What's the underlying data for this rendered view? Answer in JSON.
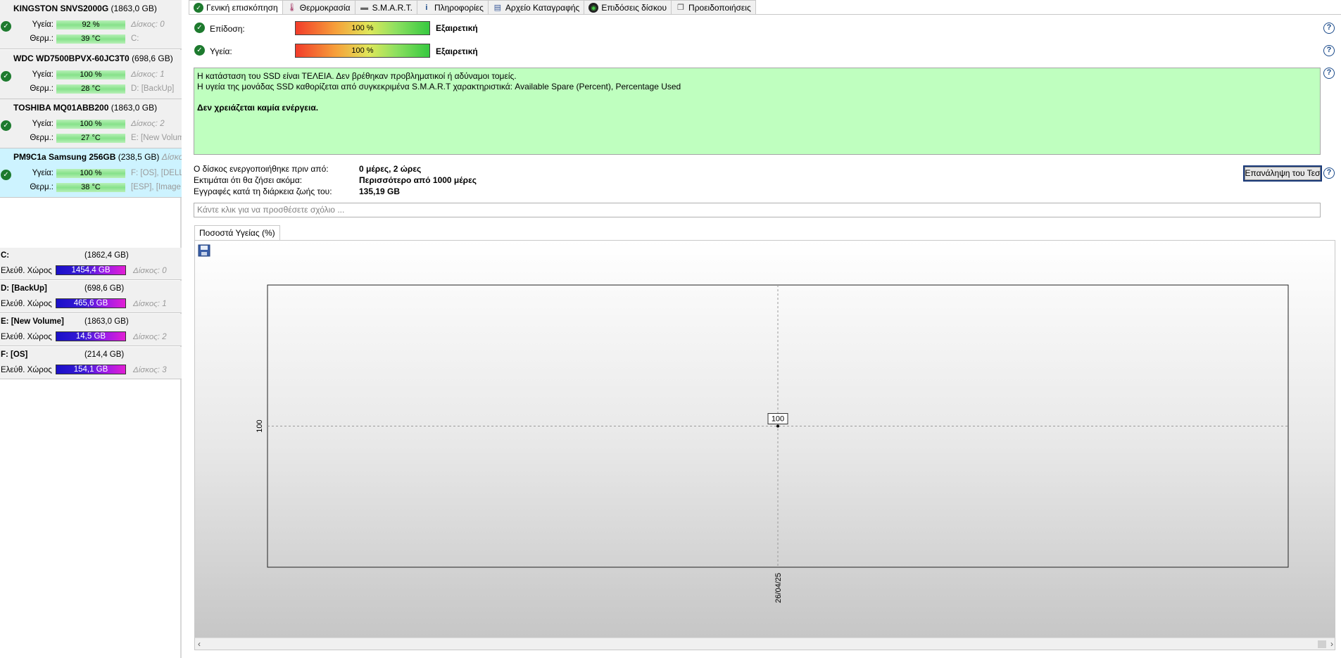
{
  "drives": [
    {
      "model": "KINGSTON SNVS2000G",
      "capacity": "(1863,0 GB)",
      "health_label": "Υγεία:",
      "health": "92 %",
      "temp_label": "Θερμ.:",
      "temp": "39 °C",
      "disk": "Δίσκος: 0",
      "volumes": "C:",
      "volumes2": ""
    },
    {
      "model": "WDC WD7500BPVX-60JC3T0",
      "capacity": "(698,6 GB)",
      "health_label": "Υγεία:",
      "health": "100 %",
      "temp_label": "Θερμ.:",
      "temp": "28 °C",
      "disk": "Δίσκος: 1",
      "volumes": "D: [BackUp]",
      "volumes2": ""
    },
    {
      "model": "TOSHIBA MQ01ABB200",
      "capacity": "(1863,0 GB)",
      "health_label": "Υγεία:",
      "health": "100 %",
      "temp_label": "Θερμ.:",
      "temp": "27 °C",
      "disk": "Δίσκος: 2",
      "volumes": "E: [New Volum",
      "volumes2": ""
    },
    {
      "model": "PM9C1a Samsung 256GB",
      "capacity": "(238,5 GB)",
      "health_label": "Υγεία:",
      "health": "100 %",
      "temp_label": "Θερμ.:",
      "temp": "38 °C",
      "disk": "Δίσκος",
      "volumes": "F: [OS],  [DELL",
      "volumes2": "[ESP],  [Image"
    }
  ],
  "volumes": [
    {
      "name": "C:",
      "size": "(1862,4 GB)",
      "free_label": "Ελεύθ. Χώρος",
      "free": "1454,4 GB",
      "disk": "Δίσκος: 0"
    },
    {
      "name": "D: [BackUp]",
      "size": "(698,6 GB)",
      "free_label": "Ελεύθ. Χώρος",
      "free": "465,6 GB",
      "disk": "Δίσκος: 1"
    },
    {
      "name": "E: [New Volume]",
      "size": "(1863,0 GB)",
      "free_label": "Ελεύθ. Χώρος",
      "free": "14,5 GB",
      "disk": "Δίσκος: 2"
    },
    {
      "name": "F: [OS]",
      "size": "(214,4 GB)",
      "free_label": "Ελεύθ. Χώρος",
      "free": "154,1 GB",
      "disk": "Δίσκος: 3"
    }
  ],
  "tabs": [
    {
      "label": "Γενική επισκόπηση",
      "icon": "check-icon"
    },
    {
      "label": "Θερμοκρασία",
      "icon": "thermometer-icon"
    },
    {
      "label": "S.M.A.R.T.",
      "icon": "smart-icon"
    },
    {
      "label": "Πληροφορίες",
      "icon": "info-icon"
    },
    {
      "label": "Αρχείο Καταγραφής",
      "icon": "log-icon"
    },
    {
      "label": "Επιδόσεις δίσκου",
      "icon": "disk-performance-icon"
    },
    {
      "label": "Προειδοποιήσεις",
      "icon": "warnings-icon"
    }
  ],
  "overview": {
    "performance_label": "Επίδοση:",
    "performance_value": "100 %",
    "performance_fraction": 1.0,
    "performance_rating": "Εξαιρετική",
    "health_label": "Υγεία:",
    "health_value": "100 %",
    "health_fraction": 1.0,
    "health_rating": "Εξαιρετική",
    "status_line1": "Η κατάσταση του SSD είναι ΤΕΛΕΙΑ. Δεν βρέθηκαν προβληματικοί ή αδύναμοι τομείς.",
    "status_line2": "Η υγεία  της μονάδας SSD καθορίζεται από συγκεκριμένα S.M.A.R.T χαρακτηριστικά: Available Spare (Percent), Percentage Used",
    "status_action": "Δεν χρειάζεται καμία ενέργεια.",
    "powered_on_label": "Ο δίσκος ενεργοποιήθηκε πριν από:",
    "powered_on_value": "0 μέρες, 2 ώρες",
    "lifetime_label": "Εκτιμάται ότι θα ζήσει ακόμα:",
    "lifetime_value": "Περισσότερο από 1000 μέρες",
    "writes_label": "Εγγραφές κατά τη διάρκεια ζωής του:",
    "writes_value": "135,19 GB",
    "retest_button": "Επανάληψη του Τεσ",
    "comment_placeholder": "Κάντε κλικ για να προσθέσετε σχόλιο ...",
    "chart_tab": "Ποσοστά Υγείας (%)"
  },
  "chart_data": {
    "type": "line",
    "x": [
      "26/04/25"
    ],
    "series": [
      {
        "values": [
          100
        ]
      }
    ],
    "y_tick_labels": [
      "100"
    ],
    "data_labels": [
      "100"
    ],
    "grid": true
  }
}
